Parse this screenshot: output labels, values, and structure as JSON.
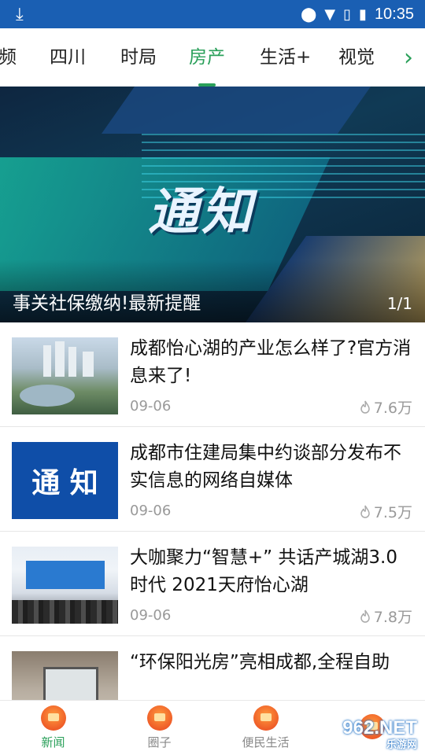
{
  "statusbar": {
    "time": "10:35"
  },
  "tabs": {
    "items": [
      {
        "label": "频"
      },
      {
        "label": "四川"
      },
      {
        "label": "时局"
      },
      {
        "label": "房产"
      },
      {
        "label": "生活+"
      },
      {
        "label": "视觉"
      }
    ],
    "active": "房产"
  },
  "banner": {
    "headline": "通知",
    "caption": "事关社保缴纳!最新提醒",
    "pager": "1/1"
  },
  "news": [
    {
      "title": "成都怡心湖的产业怎么样了?官方消息来了!",
      "date": "09-06",
      "views": "7.6万",
      "thumb_text": ""
    },
    {
      "title": "成都市住建局集中约谈部分发布不实信息的网络自媒体",
      "date": "09-06",
      "views": "7.5万",
      "thumb_text": "通 知"
    },
    {
      "title": "大咖聚力“智慧+” 共话产城湖3.0时代 2021天府怡心湖",
      "date": "09-06",
      "views": "7.8万",
      "thumb_text": ""
    },
    {
      "title": "“环保阳光房”亮相成都,全程自助",
      "date": "",
      "views": "",
      "thumb_text": ""
    }
  ],
  "bottomnav": {
    "items": [
      {
        "label": "新闻"
      },
      {
        "label": "圈子"
      },
      {
        "label": "便民生活"
      },
      {
        "label": ""
      }
    ]
  },
  "watermark": {
    "main": "962.NET",
    "sub": "乐游网"
  },
  "colors": {
    "statusbar": "#1a5fb3",
    "accent": "#2aa05a"
  }
}
